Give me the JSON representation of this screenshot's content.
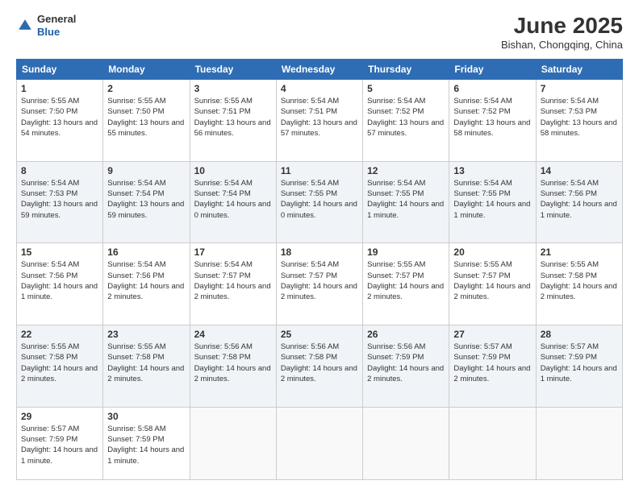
{
  "header": {
    "logo": {
      "line1": "General",
      "line2": "Blue"
    },
    "title": "June 2025",
    "subtitle": "Bishan, Chongqing, China"
  },
  "weekdays": [
    "Sunday",
    "Monday",
    "Tuesday",
    "Wednesday",
    "Thursday",
    "Friday",
    "Saturday"
  ],
  "weeks": [
    [
      {
        "day": "1",
        "sunrise": "5:55 AM",
        "sunset": "7:50 PM",
        "daylight": "13 hours and 54 minutes."
      },
      {
        "day": "2",
        "sunrise": "5:55 AM",
        "sunset": "7:50 PM",
        "daylight": "13 hours and 55 minutes."
      },
      {
        "day": "3",
        "sunrise": "5:55 AM",
        "sunset": "7:51 PM",
        "daylight": "13 hours and 56 minutes."
      },
      {
        "day": "4",
        "sunrise": "5:54 AM",
        "sunset": "7:51 PM",
        "daylight": "13 hours and 57 minutes."
      },
      {
        "day": "5",
        "sunrise": "5:54 AM",
        "sunset": "7:52 PM",
        "daylight": "13 hours and 57 minutes."
      },
      {
        "day": "6",
        "sunrise": "5:54 AM",
        "sunset": "7:52 PM",
        "daylight": "13 hours and 58 minutes."
      },
      {
        "day": "7",
        "sunrise": "5:54 AM",
        "sunset": "7:53 PM",
        "daylight": "13 hours and 58 minutes."
      }
    ],
    [
      {
        "day": "8",
        "sunrise": "5:54 AM",
        "sunset": "7:53 PM",
        "daylight": "13 hours and 59 minutes."
      },
      {
        "day": "9",
        "sunrise": "5:54 AM",
        "sunset": "7:54 PM",
        "daylight": "13 hours and 59 minutes."
      },
      {
        "day": "10",
        "sunrise": "5:54 AM",
        "sunset": "7:54 PM",
        "daylight": "14 hours and 0 minutes."
      },
      {
        "day": "11",
        "sunrise": "5:54 AM",
        "sunset": "7:55 PM",
        "daylight": "14 hours and 0 minutes."
      },
      {
        "day": "12",
        "sunrise": "5:54 AM",
        "sunset": "7:55 PM",
        "daylight": "14 hours and 1 minute."
      },
      {
        "day": "13",
        "sunrise": "5:54 AM",
        "sunset": "7:55 PM",
        "daylight": "14 hours and 1 minute."
      },
      {
        "day": "14",
        "sunrise": "5:54 AM",
        "sunset": "7:56 PM",
        "daylight": "14 hours and 1 minute."
      }
    ],
    [
      {
        "day": "15",
        "sunrise": "5:54 AM",
        "sunset": "7:56 PM",
        "daylight": "14 hours and 1 minute."
      },
      {
        "day": "16",
        "sunrise": "5:54 AM",
        "sunset": "7:56 PM",
        "daylight": "14 hours and 2 minutes."
      },
      {
        "day": "17",
        "sunrise": "5:54 AM",
        "sunset": "7:57 PM",
        "daylight": "14 hours and 2 minutes."
      },
      {
        "day": "18",
        "sunrise": "5:54 AM",
        "sunset": "7:57 PM",
        "daylight": "14 hours and 2 minutes."
      },
      {
        "day": "19",
        "sunrise": "5:55 AM",
        "sunset": "7:57 PM",
        "daylight": "14 hours and 2 minutes."
      },
      {
        "day": "20",
        "sunrise": "5:55 AM",
        "sunset": "7:57 PM",
        "daylight": "14 hours and 2 minutes."
      },
      {
        "day": "21",
        "sunrise": "5:55 AM",
        "sunset": "7:58 PM",
        "daylight": "14 hours and 2 minutes."
      }
    ],
    [
      {
        "day": "22",
        "sunrise": "5:55 AM",
        "sunset": "7:58 PM",
        "daylight": "14 hours and 2 minutes."
      },
      {
        "day": "23",
        "sunrise": "5:55 AM",
        "sunset": "7:58 PM",
        "daylight": "14 hours and 2 minutes."
      },
      {
        "day": "24",
        "sunrise": "5:56 AM",
        "sunset": "7:58 PM",
        "daylight": "14 hours and 2 minutes."
      },
      {
        "day": "25",
        "sunrise": "5:56 AM",
        "sunset": "7:58 PM",
        "daylight": "14 hours and 2 minutes."
      },
      {
        "day": "26",
        "sunrise": "5:56 AM",
        "sunset": "7:59 PM",
        "daylight": "14 hours and 2 minutes."
      },
      {
        "day": "27",
        "sunrise": "5:57 AM",
        "sunset": "7:59 PM",
        "daylight": "14 hours and 2 minutes."
      },
      {
        "day": "28",
        "sunrise": "5:57 AM",
        "sunset": "7:59 PM",
        "daylight": "14 hours and 1 minute."
      }
    ],
    [
      {
        "day": "29",
        "sunrise": "5:57 AM",
        "sunset": "7:59 PM",
        "daylight": "14 hours and 1 minute."
      },
      {
        "day": "30",
        "sunrise": "5:58 AM",
        "sunset": "7:59 PM",
        "daylight": "14 hours and 1 minute."
      },
      null,
      null,
      null,
      null,
      null
    ]
  ]
}
